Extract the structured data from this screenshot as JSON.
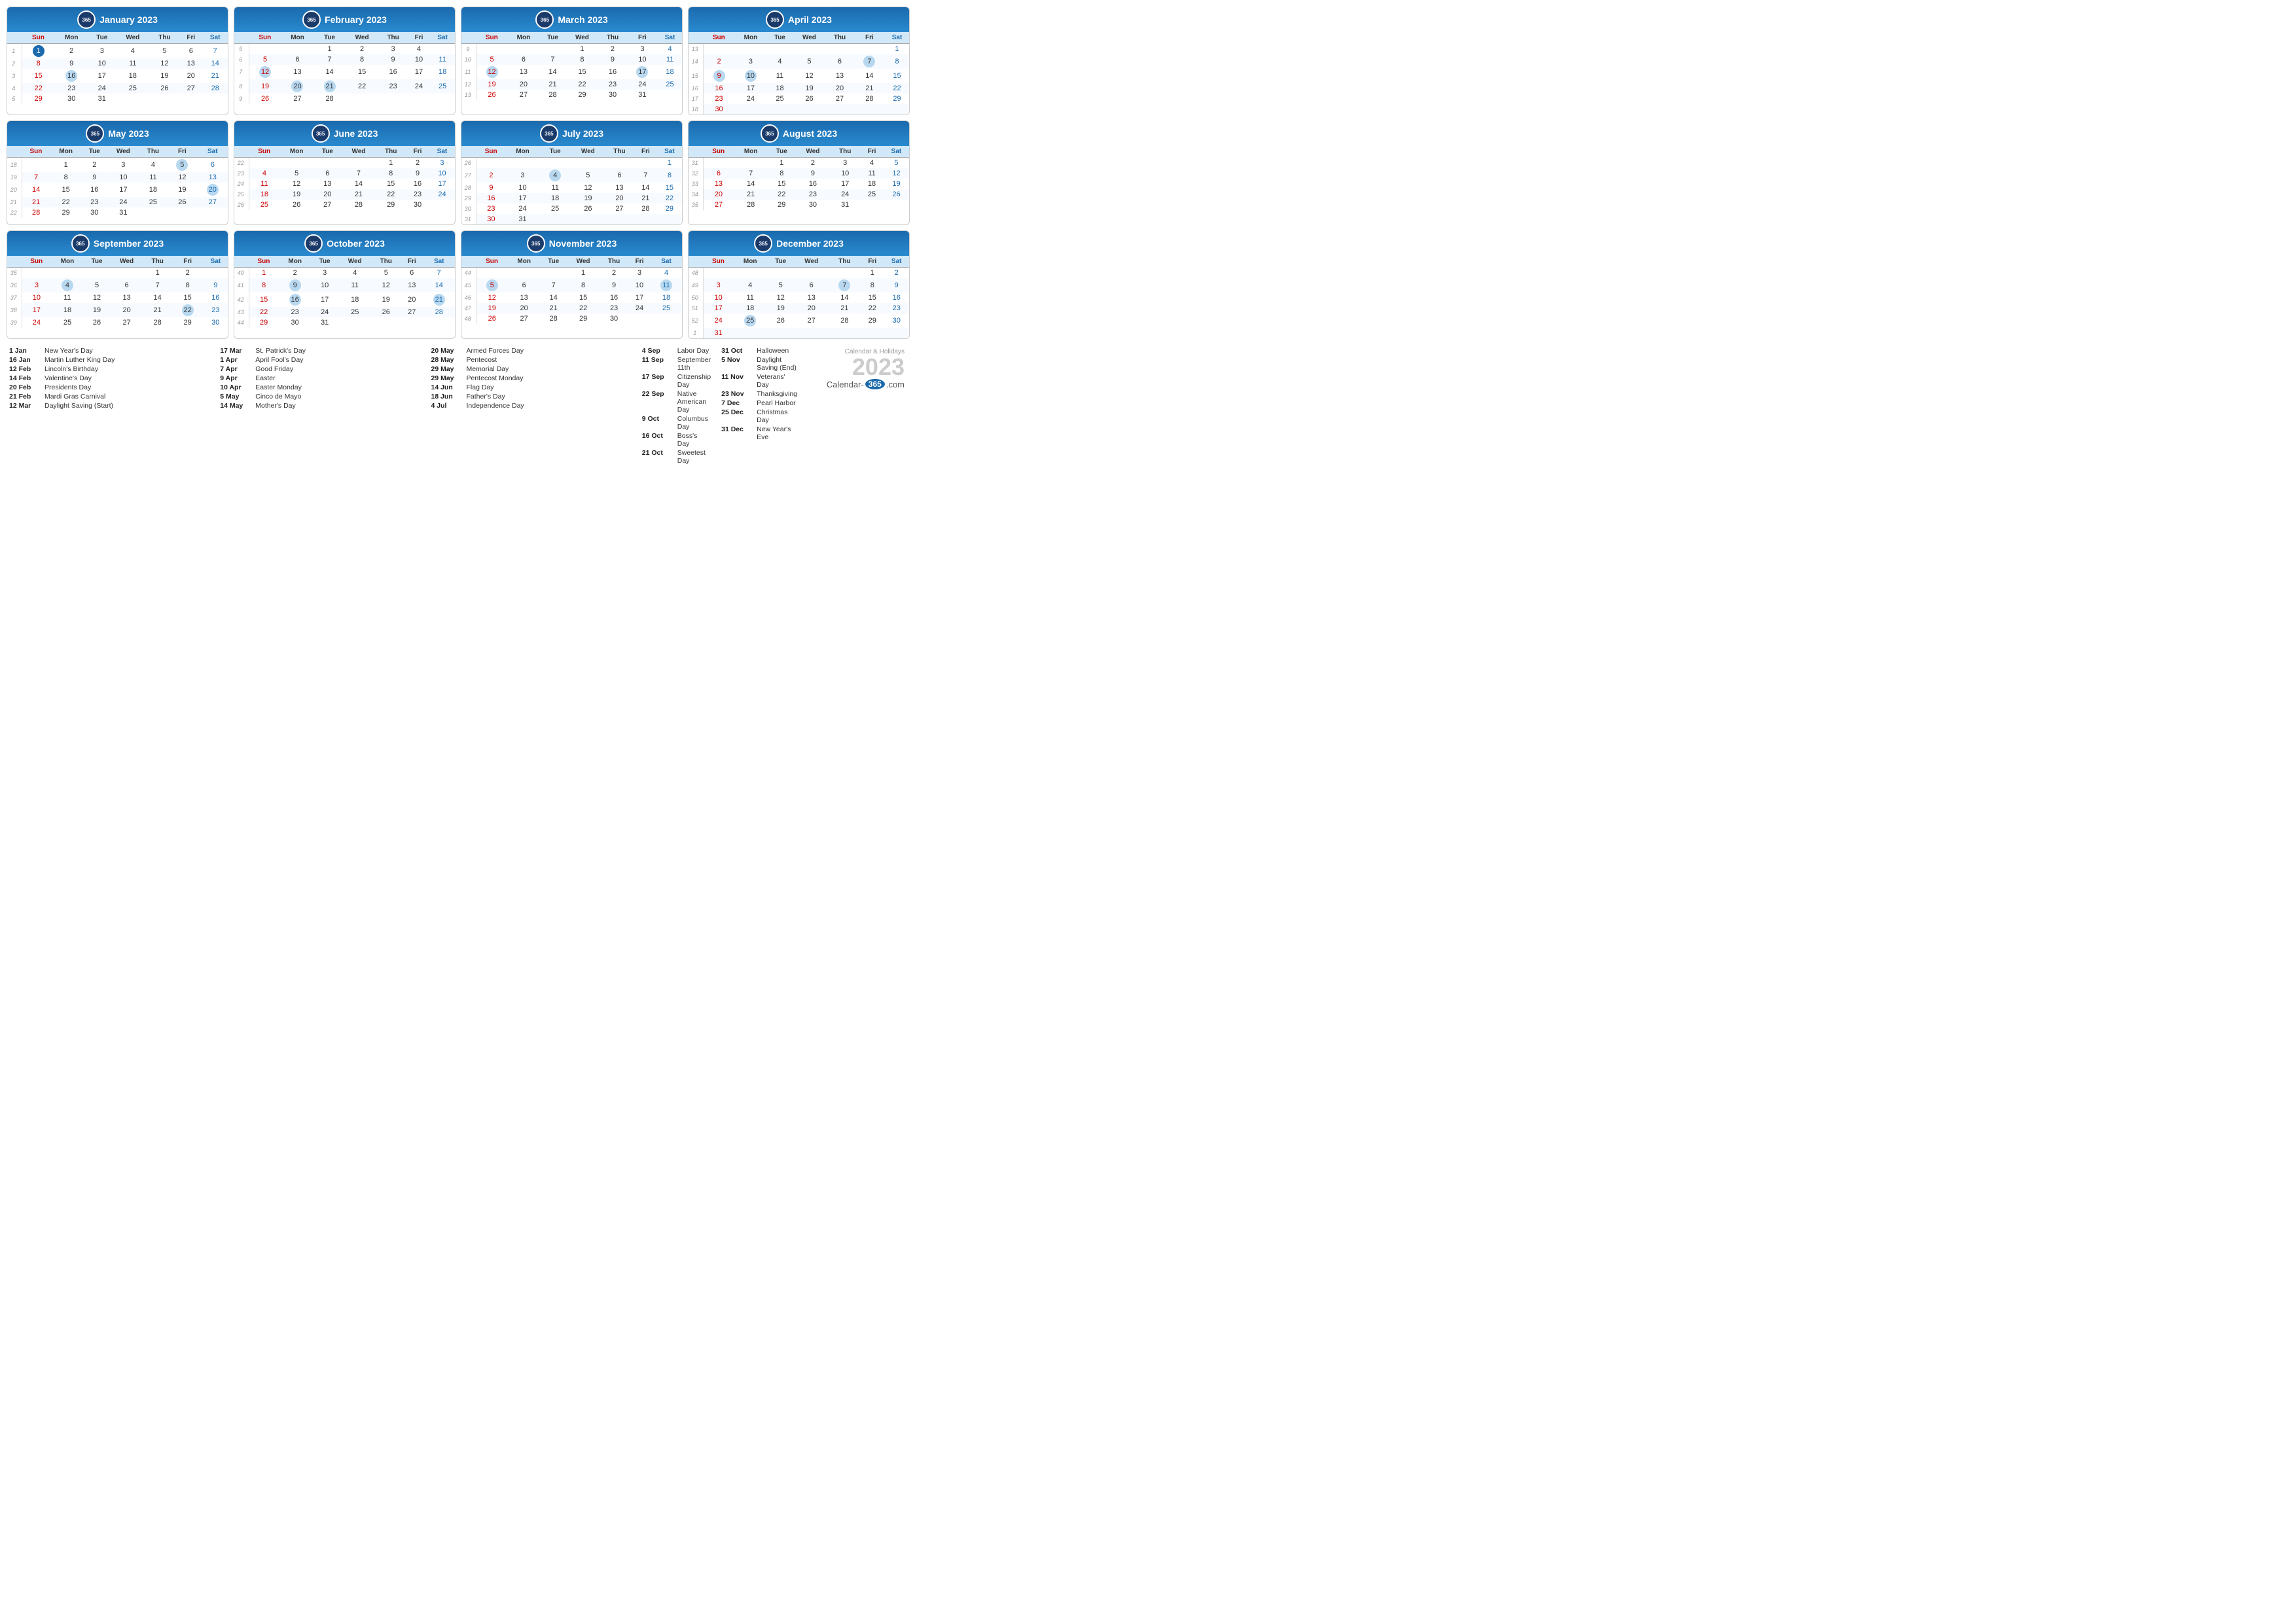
{
  "title": "Calendar & Holidays 2023",
  "months": [
    {
      "name": "January 2023",
      "weeks": [
        {
          "wn": "1",
          "days": [
            "1",
            "2",
            "3",
            "4",
            "5",
            "6",
            "7"
          ],
          "highlights": [
            "1"
          ],
          "sun": true
        },
        {
          "wn": "2",
          "days": [
            "8",
            "9",
            "10",
            "11",
            "12",
            "13",
            "14"
          ]
        },
        {
          "wn": "3",
          "days": [
            "15",
            "16",
            "17",
            "18",
            "19",
            "20",
            "21"
          ],
          "blue": [
            "16"
          ]
        },
        {
          "wn": "4",
          "days": [
            "22",
            "23",
            "24",
            "25",
            "26",
            "27",
            "28"
          ]
        },
        {
          "wn": "5",
          "days": [
            "29",
            "30",
            "31",
            "",
            "",
            "",
            ""
          ]
        }
      ]
    },
    {
      "name": "February 2023",
      "weeks": [
        {
          "wn": "5",
          "days": [
            "",
            "",
            "1",
            "2",
            "3",
            "4",
            ""
          ]
        },
        {
          "wn": "6",
          "days": [
            "5",
            "6",
            "7",
            "8",
            "9",
            "10",
            "11"
          ]
        },
        {
          "wn": "7",
          "days": [
            "12",
            "13",
            "14",
            "15",
            "16",
            "17",
            "18"
          ],
          "blue": [
            "12"
          ]
        },
        {
          "wn": "8",
          "days": [
            "19",
            "20",
            "21",
            "22",
            "23",
            "24",
            "25"
          ],
          "blue": [
            "20",
            "21"
          ]
        },
        {
          "wn": "9",
          "days": [
            "26",
            "27",
            "28",
            "",
            "",
            "",
            ""
          ]
        }
      ]
    },
    {
      "name": "March 2023",
      "weeks": [
        {
          "wn": "9",
          "days": [
            "",
            "",
            "",
            "1",
            "2",
            "3",
            "4"
          ]
        },
        {
          "wn": "10",
          "days": [
            "5",
            "6",
            "7",
            "8",
            "9",
            "10",
            "11"
          ]
        },
        {
          "wn": "11",
          "days": [
            "12",
            "13",
            "14",
            "15",
            "16",
            "17",
            "18"
          ],
          "blue": [
            "12",
            "17"
          ]
        },
        {
          "wn": "12",
          "days": [
            "19",
            "20",
            "21",
            "22",
            "23",
            "24",
            "25"
          ]
        },
        {
          "wn": "13",
          "days": [
            "26",
            "27",
            "28",
            "29",
            "30",
            "31",
            ""
          ]
        }
      ]
    },
    {
      "name": "April 2023",
      "weeks": [
        {
          "wn": "13",
          "days": [
            "",
            "",
            "",
            "",
            "",
            "",
            "1"
          ]
        },
        {
          "wn": "14",
          "days": [
            "2",
            "3",
            "4",
            "5",
            "6",
            "7",
            "8"
          ],
          "blue": [
            "7"
          ]
        },
        {
          "wn": "15",
          "days": [
            "9",
            "10",
            "11",
            "12",
            "13",
            "14",
            "15"
          ],
          "blue": [
            "9",
            "10"
          ]
        },
        {
          "wn": "16",
          "days": [
            "16",
            "17",
            "18",
            "19",
            "20",
            "21",
            "22"
          ]
        },
        {
          "wn": "17",
          "days": [
            "23",
            "24",
            "25",
            "26",
            "27",
            "28",
            "29"
          ]
        },
        {
          "wn": "18",
          "days": [
            "30",
            "",
            "",
            "",
            "",
            "",
            ""
          ]
        }
      ]
    },
    {
      "name": "May 2023",
      "weeks": [
        {
          "wn": "18",
          "days": [
            "",
            "1",
            "2",
            "3",
            "4",
            "5",
            "6"
          ],
          "blue": [
            "5"
          ]
        },
        {
          "wn": "19",
          "days": [
            "7",
            "8",
            "9",
            "10",
            "11",
            "12",
            "13"
          ]
        },
        {
          "wn": "20",
          "days": [
            "14",
            "15",
            "16",
            "17",
            "18",
            "19",
            "20"
          ],
          "blue": [
            "20"
          ]
        },
        {
          "wn": "21",
          "days": [
            "21",
            "22",
            "23",
            "24",
            "25",
            "26",
            "27"
          ]
        },
        {
          "wn": "22",
          "days": [
            "28",
            "29",
            "30",
            "31",
            "",
            "",
            ""
          ]
        }
      ]
    },
    {
      "name": "June 2023",
      "weeks": [
        {
          "wn": "22",
          "days": [
            "",
            "",
            "",
            "",
            "1",
            "2",
            "3"
          ]
        },
        {
          "wn": "23",
          "days": [
            "4",
            "5",
            "6",
            "7",
            "8",
            "9",
            "10"
          ]
        },
        {
          "wn": "24",
          "days": [
            "11",
            "12",
            "13",
            "14",
            "15",
            "16",
            "17"
          ]
        },
        {
          "wn": "25",
          "days": [
            "18",
            "19",
            "20",
            "21",
            "22",
            "23",
            "24"
          ]
        },
        {
          "wn": "26",
          "days": [
            "25",
            "26",
            "27",
            "28",
            "29",
            "30",
            ""
          ]
        }
      ]
    },
    {
      "name": "July 2023",
      "weeks": [
        {
          "wn": "26",
          "days": [
            "",
            "",
            "",
            "",
            "",
            "",
            "1"
          ]
        },
        {
          "wn": "27",
          "days": [
            "2",
            "3",
            "4",
            "5",
            "6",
            "7",
            "8"
          ],
          "blue": [
            "4"
          ]
        },
        {
          "wn": "28",
          "days": [
            "9",
            "10",
            "11",
            "12",
            "13",
            "14",
            "15"
          ]
        },
        {
          "wn": "29",
          "days": [
            "16",
            "17",
            "18",
            "19",
            "20",
            "21",
            "22"
          ]
        },
        {
          "wn": "30",
          "days": [
            "23",
            "24",
            "25",
            "26",
            "27",
            "28",
            "29"
          ]
        },
        {
          "wn": "31",
          "days": [
            "30",
            "31",
            "",
            "",
            "",
            "",
            ""
          ]
        }
      ]
    },
    {
      "name": "August 2023",
      "weeks": [
        {
          "wn": "31",
          "days": [
            "",
            "",
            "1",
            "2",
            "3",
            "4",
            "5"
          ]
        },
        {
          "wn": "32",
          "days": [
            "6",
            "7",
            "8",
            "9",
            "10",
            "11",
            "12"
          ]
        },
        {
          "wn": "33",
          "days": [
            "13",
            "14",
            "15",
            "16",
            "17",
            "18",
            "19"
          ]
        },
        {
          "wn": "34",
          "days": [
            "20",
            "21",
            "22",
            "23",
            "24",
            "25",
            "26"
          ]
        },
        {
          "wn": "35",
          "days": [
            "27",
            "28",
            "29",
            "30",
            "31",
            "",
            ""
          ]
        }
      ]
    },
    {
      "name": "September 2023",
      "weeks": [
        {
          "wn": "35",
          "days": [
            "",
            "",
            "",
            "",
            "1",
            "2",
            ""
          ]
        },
        {
          "wn": "36",
          "days": [
            "3",
            "4",
            "5",
            "6",
            "7",
            "8",
            "9"
          ],
          "blue": [
            "4"
          ]
        },
        {
          "wn": "37",
          "days": [
            "10",
            "11",
            "12",
            "13",
            "14",
            "15",
            "16"
          ]
        },
        {
          "wn": "38",
          "days": [
            "17",
            "18",
            "19",
            "20",
            "21",
            "22",
            "23"
          ],
          "blue": [
            "22"
          ]
        },
        {
          "wn": "39",
          "days": [
            "24",
            "25",
            "26",
            "27",
            "28",
            "29",
            "30"
          ]
        }
      ]
    },
    {
      "name": "October 2023",
      "weeks": [
        {
          "wn": "40",
          "days": [
            "1",
            "2",
            "3",
            "4",
            "5",
            "6",
            "7"
          ]
        },
        {
          "wn": "41",
          "days": [
            "8",
            "9",
            "10",
            "11",
            "12",
            "13",
            "14"
          ],
          "blue": [
            "9"
          ]
        },
        {
          "wn": "42",
          "days": [
            "15",
            "16",
            "17",
            "18",
            "19",
            "20",
            "21"
          ],
          "blue": [
            "16",
            "21"
          ]
        },
        {
          "wn": "43",
          "days": [
            "22",
            "23",
            "24",
            "25",
            "26",
            "27",
            "28"
          ]
        },
        {
          "wn": "44",
          "days": [
            "29",
            "30",
            "31",
            "",
            "",
            "",
            ""
          ]
        }
      ]
    },
    {
      "name": "November 2023",
      "weeks": [
        {
          "wn": "44",
          "days": [
            "",
            "",
            "",
            "1",
            "2",
            "3",
            "4"
          ]
        },
        {
          "wn": "45",
          "days": [
            "5",
            "6",
            "7",
            "8",
            "9",
            "10",
            "11"
          ],
          "blue": [
            "5",
            "11"
          ]
        },
        {
          "wn": "46",
          "days": [
            "12",
            "13",
            "14",
            "15",
            "16",
            "17",
            "18"
          ]
        },
        {
          "wn": "47",
          "days": [
            "19",
            "20",
            "21",
            "22",
            "23",
            "24",
            "25"
          ]
        },
        {
          "wn": "48",
          "days": [
            "26",
            "27",
            "28",
            "29",
            "30",
            "",
            ""
          ]
        }
      ]
    },
    {
      "name": "December 2023",
      "weeks": [
        {
          "wn": "48",
          "days": [
            "",
            "",
            "",
            "",
            "",
            "1",
            "2"
          ]
        },
        {
          "wn": "49",
          "days": [
            "3",
            "4",
            "5",
            "6",
            "7",
            "8",
            "9"
          ],
          "blue": [
            "7"
          ]
        },
        {
          "wn": "50",
          "days": [
            "10",
            "11",
            "12",
            "13",
            "14",
            "15",
            "16"
          ]
        },
        {
          "wn": "51",
          "days": [
            "17",
            "18",
            "19",
            "20",
            "21",
            "22",
            "23"
          ]
        },
        {
          "wn": "52",
          "days": [
            "24",
            "25",
            "26",
            "27",
            "28",
            "29",
            "30"
          ],
          "blue": [
            "25"
          ]
        },
        {
          "wn": "1",
          "days": [
            "31",
            "",
            "",
            "",
            "",
            "",
            ""
          ]
        }
      ]
    }
  ],
  "holidays": {
    "col1": [
      {
        "date": "1 Jan",
        "name": "New Year's Day"
      },
      {
        "date": "16 Jan",
        "name": "Martin Luther King Day"
      },
      {
        "date": "12 Feb",
        "name": "Lincoln's Birthday"
      },
      {
        "date": "14 Feb",
        "name": "Valentine's Day"
      },
      {
        "date": "20 Feb",
        "name": "Presidents Day"
      },
      {
        "date": "21 Feb",
        "name": "Mardi Gras Carnival"
      },
      {
        "date": "12 Mar",
        "name": "Daylight Saving (Start)"
      }
    ],
    "col2": [
      {
        "date": "17 Mar",
        "name": "St. Patrick's Day"
      },
      {
        "date": "1 Apr",
        "name": "April Fool's Day"
      },
      {
        "date": "7 Apr",
        "name": "Good Friday"
      },
      {
        "date": "9 Apr",
        "name": "Easter"
      },
      {
        "date": "10 Apr",
        "name": "Easter Monday"
      },
      {
        "date": "5 May",
        "name": "Cinco de Mayo"
      },
      {
        "date": "14 May",
        "name": "Mother's Day"
      }
    ],
    "col3": [
      {
        "date": "20 May",
        "name": "Armed Forces Day"
      },
      {
        "date": "28 May",
        "name": "Pentecost"
      },
      {
        "date": "29 May",
        "name": "Memorial Day"
      },
      {
        "date": "29 May",
        "name": "Pentecost Monday"
      },
      {
        "date": "14 Jun",
        "name": "Flag Day"
      },
      {
        "date": "18 Jun",
        "name": "Father's Day"
      },
      {
        "date": "4 Jul",
        "name": "Independence Day"
      }
    ],
    "col4": [
      {
        "date": "4 Sep",
        "name": "Labor Day"
      },
      {
        "date": "11 Sep",
        "name": "September 11th"
      },
      {
        "date": "17 Sep",
        "name": "Citizenship Day"
      },
      {
        "date": "22 Sep",
        "name": "Native American Day"
      },
      {
        "date": "9 Oct",
        "name": "Columbus Day"
      },
      {
        "date": "16 Oct",
        "name": "Boss's Day"
      },
      {
        "date": "21 Oct",
        "name": "Sweetest Day"
      }
    ],
    "col5": [
      {
        "date": "31 Oct",
        "name": "Halloween"
      },
      {
        "date": "5 Nov",
        "name": "Daylight Saving (End)"
      },
      {
        "date": "11 Nov",
        "name": "Veterans' Day"
      },
      {
        "date": "23 Nov",
        "name": "Thanksgiving"
      },
      {
        "date": "7 Dec",
        "name": "Pearl Harbor"
      },
      {
        "date": "25 Dec",
        "name": "Christmas Day"
      },
      {
        "date": "31 Dec",
        "name": "New Year's Eve"
      }
    ]
  },
  "branding": {
    "label": "Calendar & Holidays",
    "year": "2023",
    "url_prefix": "Calendar-",
    "url_badge": "365",
    "url_suffix": ".com"
  },
  "days_header": [
    "Sun",
    "Mon",
    "Tue",
    "Wed",
    "Thu",
    "Fri",
    "Sat"
  ]
}
